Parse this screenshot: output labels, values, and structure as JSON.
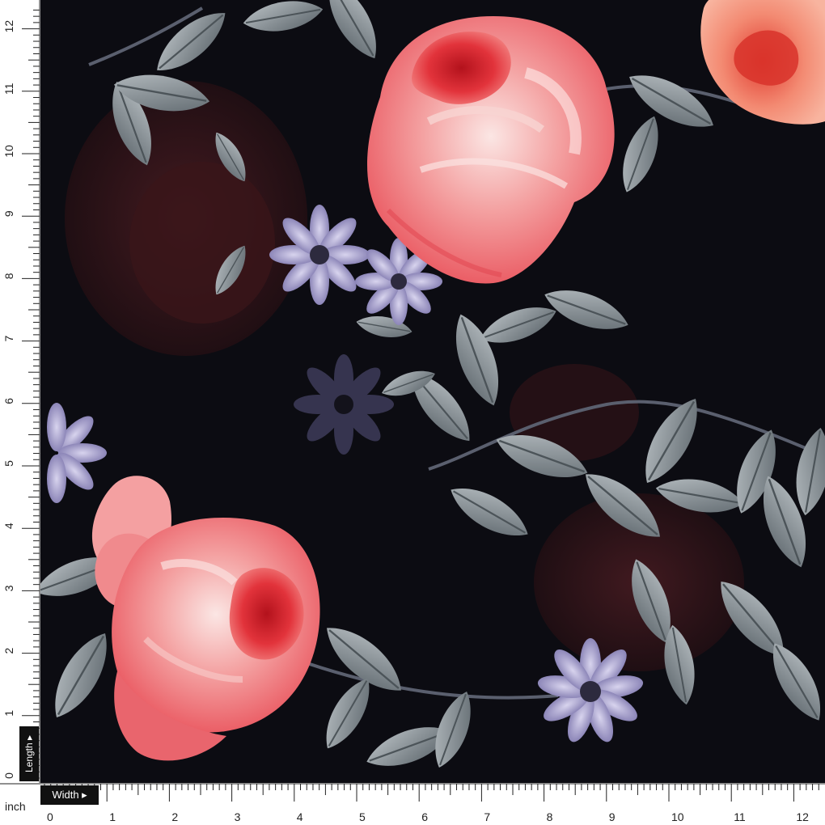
{
  "rulers": {
    "unit": "inch",
    "length_label": "Length ▸",
    "width_label": "Width ▸",
    "vertical_ticks": [
      "0",
      "1",
      "2",
      "3",
      "4",
      "5",
      "6",
      "7",
      "8",
      "9",
      "10",
      "11",
      "12"
    ],
    "horizontal_ticks": [
      "0",
      "1",
      "2",
      "3",
      "4",
      "5",
      "6",
      "7",
      "8",
      "9",
      "10",
      "11",
      "12"
    ]
  },
  "palette": {
    "background": "#0c0c12",
    "rose_pink": "#f07f7f",
    "rose_red": "#e8343a",
    "leaf_grey": "#8a9196",
    "daisy_lavender": "#9a93c4",
    "dark_rose": "#3a1a1e"
  }
}
